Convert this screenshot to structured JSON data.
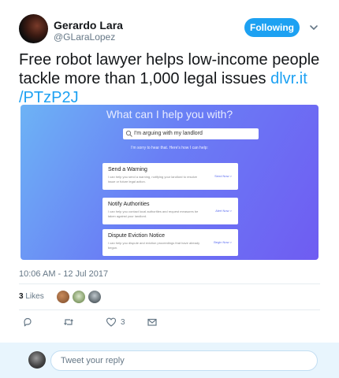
{
  "author": {
    "name": "Gerardo Lara",
    "handle": "@GLaraLopez"
  },
  "follow_button_label": "Following",
  "tweet": {
    "text": "Free robot lawyer helps low-income people tackle more than 1,000 legal issues",
    "link_part1": "dlvr.it",
    "link_part2": "/PTzP2J"
  },
  "media": {
    "title": "What can I help you with?",
    "search_value": "I'm arguing with my landlord",
    "subtitle": "I'm sorry to hear that. Here's how I can help:",
    "cards": [
      {
        "title": "Send a Warning",
        "desc": "I can help you send a warning, notifying your landlord to resolve issue or future legal action.",
        "action": "Send Now >"
      },
      {
        "title": "Notify Authorities",
        "desc": "I can help you contact local authorities and request measures be taken against your landlord.",
        "action": "Alert Now >"
      },
      {
        "title": "Dispute Eviction Notice",
        "desc": "I can help you dispute and eviction proceedings that have already begun.",
        "action": "Begin Now >"
      }
    ]
  },
  "timestamp": "10:06 AM - 12 Jul 2017",
  "likes": {
    "count": "3",
    "label": "Likes"
  },
  "actions": {
    "like_count": "3"
  },
  "reply_placeholder": "Tweet your reply",
  "colors": {
    "accent": "#1da1f2",
    "muted": "#657786"
  }
}
